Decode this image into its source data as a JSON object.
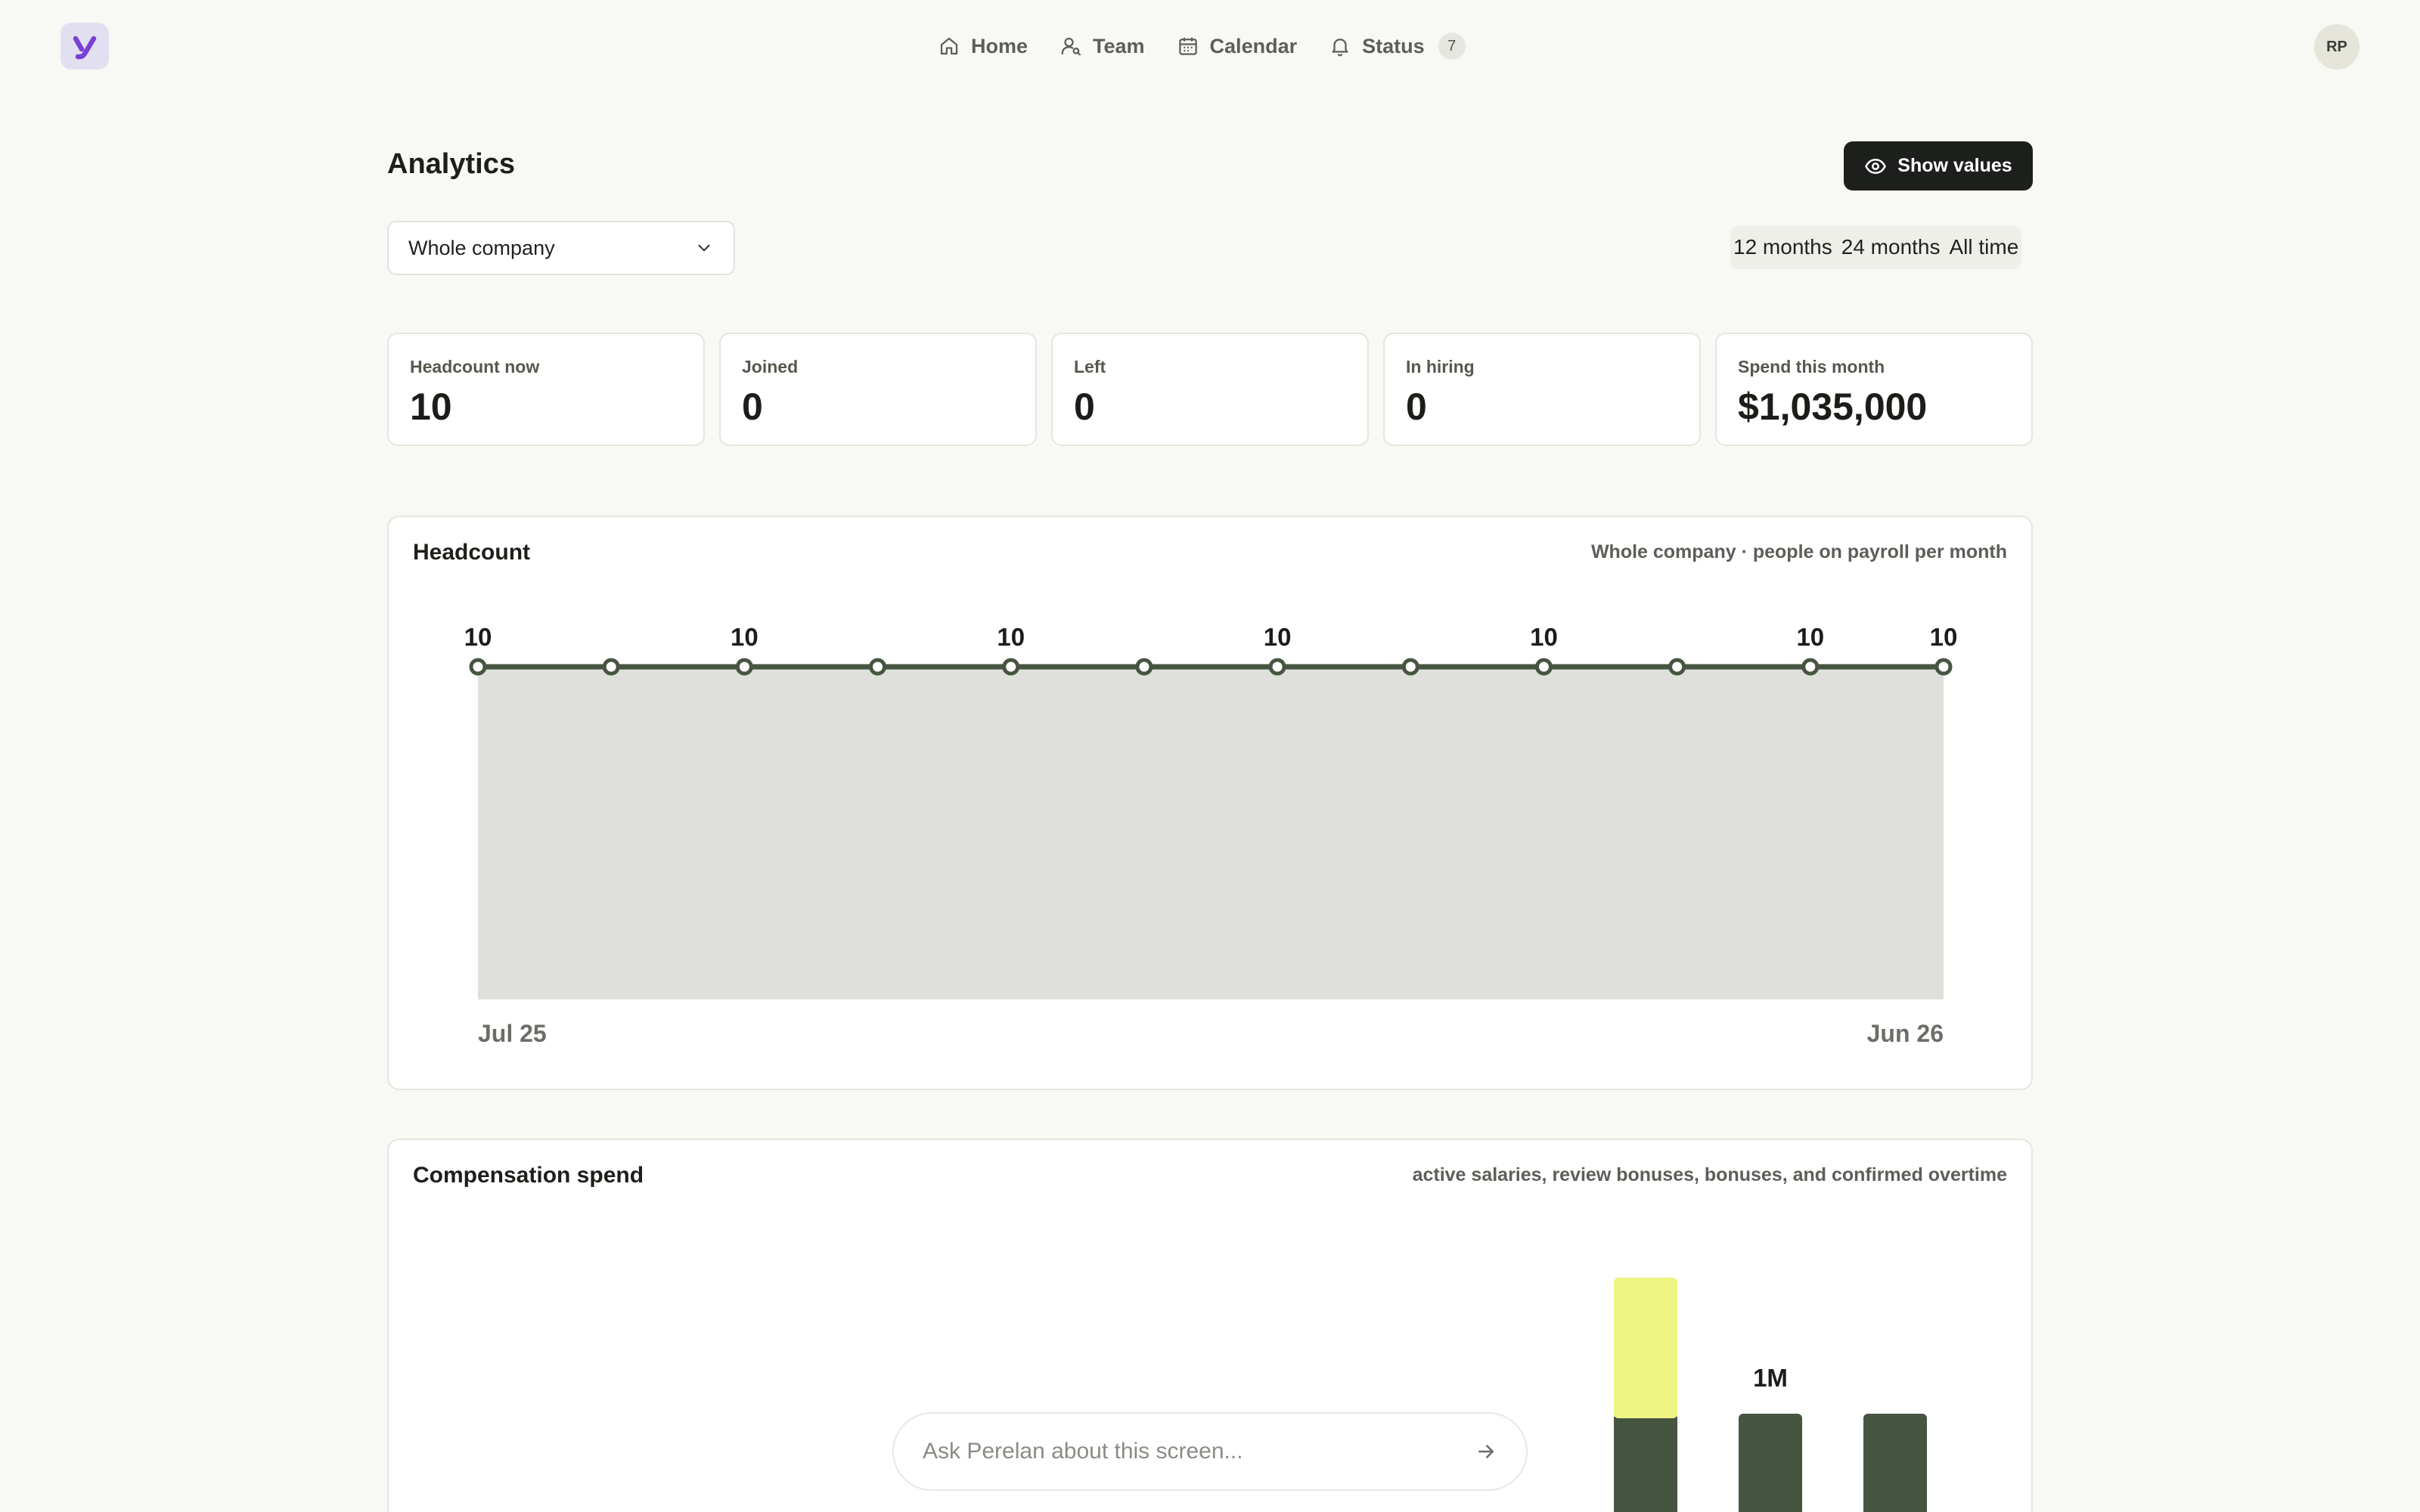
{
  "nav": {
    "items": [
      {
        "label": "Home",
        "icon": "home-icon"
      },
      {
        "label": "Team",
        "icon": "person-icon"
      },
      {
        "label": "Calendar",
        "icon": "calendar-icon"
      },
      {
        "label": "Status",
        "icon": "bell-icon"
      }
    ],
    "status_count": "7",
    "avatar_initials": "RP"
  },
  "header": {
    "title": "Analytics",
    "show_values_label": "Show values",
    "scope_select": "Whole company",
    "ranges": [
      "12 months",
      "24 months",
      "All time"
    ]
  },
  "stats": [
    {
      "label": "Headcount now",
      "value": "10"
    },
    {
      "label": "Joined",
      "value": "0"
    },
    {
      "label": "Left",
      "value": "0"
    },
    {
      "label": "In hiring",
      "value": "0"
    },
    {
      "label": "Spend this month",
      "value": "$1,035,000"
    }
  ],
  "headcount": {
    "title": "Headcount",
    "subtitle": "Whole company · people on payroll per month"
  },
  "compensation": {
    "title": "Compensation spend",
    "subtitle": "active salaries, review bonuses, bonuses, and confirmed overtime"
  },
  "ask": {
    "placeholder": "Ask Perelan about this screen..."
  },
  "colors": {
    "accent_dark": "#465540",
    "accent_lime": "#eef582",
    "area_fill": "#dfe0dc",
    "logo": "#7a3fd6"
  },
  "chart_data": [
    {
      "type": "area",
      "title": "Headcount",
      "subtitle": "Whole company · people on payroll per month",
      "x_start_label": "Jul 25",
      "x_end_label": "Jun 26",
      "values": [
        10,
        10,
        10,
        10,
        10,
        10,
        10,
        10,
        10,
        10,
        10,
        10
      ],
      "labeled_indices": [
        0,
        2,
        4,
        6,
        8,
        10,
        11
      ],
      "ylim": [
        0,
        10
      ],
      "grid": false
    },
    {
      "type": "bar",
      "title": "Compensation spend",
      "stacked": true,
      "visible_bars": [
        {
          "segments": [
            1000000,
            1000000
          ]
        },
        {
          "segments": [
            1000000
          ],
          "label": "1M"
        },
        {
          "segments": [
            1000000
          ]
        }
      ],
      "series_colors": [
        "#465540",
        "#eef582"
      ]
    }
  ]
}
